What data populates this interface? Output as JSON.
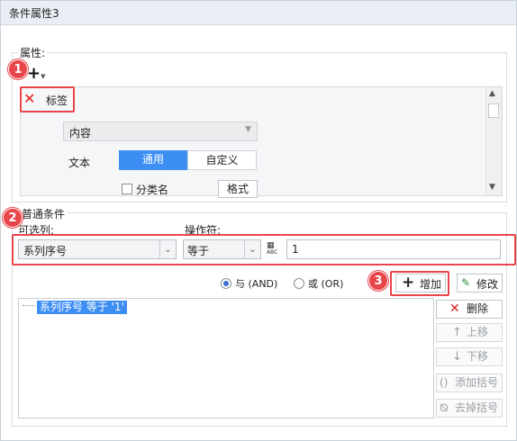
{
  "window": {
    "title": "条件属性3"
  },
  "properties": {
    "legend": "属性:",
    "tag_label": "标签",
    "content_label": "内容",
    "text_label": "文本",
    "tab_general": "通用",
    "tab_custom": "自定义",
    "category_label": "分类名",
    "format_button": "格式"
  },
  "conditions": {
    "legend": "普通条件",
    "column_label": "可选列:",
    "operator_label": "操作符:",
    "column_value": "系列序号",
    "operator_value": "等于",
    "value_input": "1",
    "abc_icon_text": "ABC",
    "radio_and": "与 (AND)",
    "radio_or": "或 (OR)",
    "add_button": "增加",
    "modify_button": "修改",
    "list_items": [
      "系列序号 等于 '1'"
    ],
    "delete_button": "删除",
    "move_up_button": "上移",
    "move_down_button": "下移",
    "add_bracket_button": "添加括号",
    "remove_bracket_button": "去掉括号"
  },
  "annotations": {
    "badge_1": "1",
    "badge_2": "2",
    "badge_3": "3"
  },
  "colors": {
    "accent": "#3d8ef3",
    "highlight": "#e8454a",
    "delete_red": "#e02020"
  }
}
